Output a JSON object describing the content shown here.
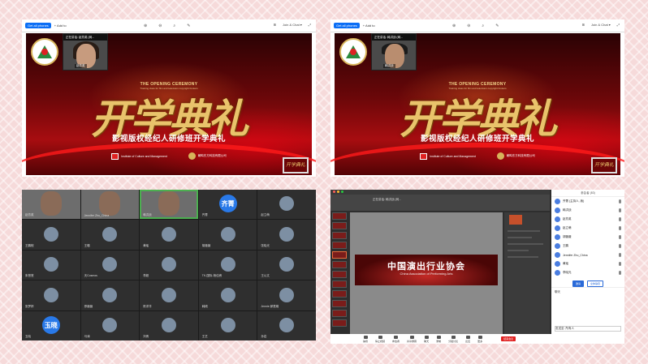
{
  "colors": {
    "background": "#f6dada",
    "accent": "#0b6ef5",
    "end_button": "#e02020",
    "slide_gold": "#e9c36b"
  },
  "toolbar": {
    "share_label": "Get all phones",
    "add_label": "+ Add to",
    "view_label": "Join & Chat ▾"
  },
  "panel1": {
    "cam_title": "正在讲话: 赵芳英 (网...",
    "cam_label": "赵芳英",
    "title_en": "THE OPENING CEREMONY",
    "title_en_sub": "Training class for film and television copyright brokers",
    "title_cn_big": "开学典礼",
    "subtitle": "影视版权经纪人研修班开学典礼",
    "sponsor1": "Institute of Culture and Management",
    "sponsor2": "朝鸣东方科技有限公司",
    "mini_label": "开学典礼"
  },
  "panel2": {
    "cam_title": "正在讲话: 韩洪战 (网...",
    "cam_label": "韩洪战",
    "title_en": "THE OPENING CEREMONY",
    "title_en_sub": "Training class for film and television copyright brokers",
    "title_cn_big": "开学典礼",
    "subtitle": "影视版权经纪人研修班开学典礼",
    "sponsor1": "Institute of Culture and Management",
    "sponsor2": "朝鸣东方科技有限公司",
    "mini_label": "开学典礼"
  },
  "gallery": {
    "tiles": [
      {
        "name": "赵芳英",
        "kind": "video"
      },
      {
        "name": "Jennifer Zhu_China",
        "kind": "video"
      },
      {
        "name": "韩洪战",
        "kind": "video",
        "highlight": true
      },
      {
        "name": "齐菁",
        "kind": "text",
        "initials": "齐菁"
      },
      {
        "name": "赵立萌",
        "kind": "avatar"
      },
      {
        "name": "王鹏程",
        "kind": "avatar"
      },
      {
        "name": "王璐",
        "kind": "avatar"
      },
      {
        "name": "黄瑶",
        "kind": "avatar"
      },
      {
        "name": "胡薇薇",
        "kind": "avatar"
      },
      {
        "name": "张晓光",
        "kind": "avatar"
      },
      {
        "name": "朱慧慧",
        "kind": "avatar"
      },
      {
        "name": "天Cosmos",
        "kind": "avatar"
      },
      {
        "name": "李超",
        "kind": "avatar"
      },
      {
        "name": "TK-国际-杨佳睿",
        "kind": "avatar"
      },
      {
        "name": "王以文",
        "kind": "avatar"
      },
      {
        "name": "张梦婷",
        "kind": "avatar"
      },
      {
        "name": "郑薇薇",
        "kind": "avatar"
      },
      {
        "name": "陈洋洋",
        "kind": "avatar"
      },
      {
        "name": "韩硕",
        "kind": "avatar"
      },
      {
        "name": "Jennie 郝慧娟",
        "kind": "avatar"
      },
      {
        "name": "玉晓",
        "kind": "text",
        "initials": "玉晓"
      },
      {
        "name": "马涛",
        "kind": "avatar"
      },
      {
        "name": "刘倩",
        "kind": "avatar"
      },
      {
        "name": "王艺",
        "kind": "avatar"
      },
      {
        "name": "孙岩",
        "kind": "avatar"
      }
    ]
  },
  "panel4": {
    "window_title": "正在讲话: 韩洪战 (网...",
    "banner_cn": "中国演出行业协会",
    "banner_en": "China Association of Performing Arts",
    "side_header": "参会者 (83)",
    "participants": [
      {
        "name": "齐菁 (主持人, 我)"
      },
      {
        "name": "韩洪战"
      },
      {
        "name": "赵芳英"
      },
      {
        "name": "赵立萌"
      },
      {
        "name": "胡薇薇"
      },
      {
        "name": "王鹏"
      },
      {
        "name": "Jennifer Zhu_China"
      },
      {
        "name": "黄瑶"
      },
      {
        "name": "李晓光"
      }
    ],
    "btn_invite": "邀请",
    "btn_mute": "全体静音",
    "chat_header": "聊天",
    "chat_to": "发送至: 所有人",
    "controls": [
      "静音",
      "停止视频",
      "参会者",
      "共享屏幕",
      "聊天",
      "录制",
      "分组讨论",
      "反应",
      "更多"
    ],
    "end_label": "结束会议"
  }
}
